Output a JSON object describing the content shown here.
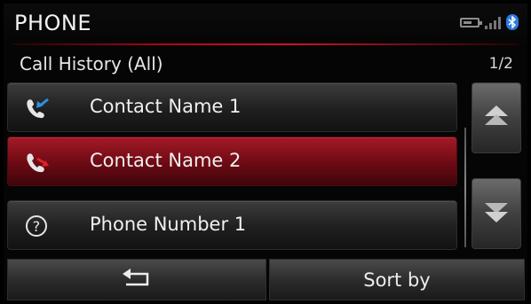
{
  "header": {
    "title": "PHONE",
    "status_icons": [
      "battery-icon",
      "signal-icon",
      "bluetooth-icon"
    ]
  },
  "subheader": {
    "title": "Call History (All)",
    "page_indicator": "1/2"
  },
  "call_list": [
    {
      "label": "Contact Name 1",
      "icon": "incoming-call-icon",
      "selected": false
    },
    {
      "label": "Contact Name 2",
      "icon": "missed-call-icon",
      "selected": true
    },
    {
      "label": "Phone Number 1",
      "icon": "unknown-caller-icon",
      "selected": false
    }
  ],
  "scroll": {
    "up_icon": "scroll-up-icon",
    "down_icon": "scroll-down-icon"
  },
  "bottom_bar": {
    "back_icon": "back-arrow-icon",
    "sort_label": "Sort by"
  },
  "colors": {
    "accent_red": "#a41a26",
    "incoming_blue": "#2f8fe6",
    "missed_red": "#e0202a",
    "bluetooth_blue": "#2a7be0"
  }
}
